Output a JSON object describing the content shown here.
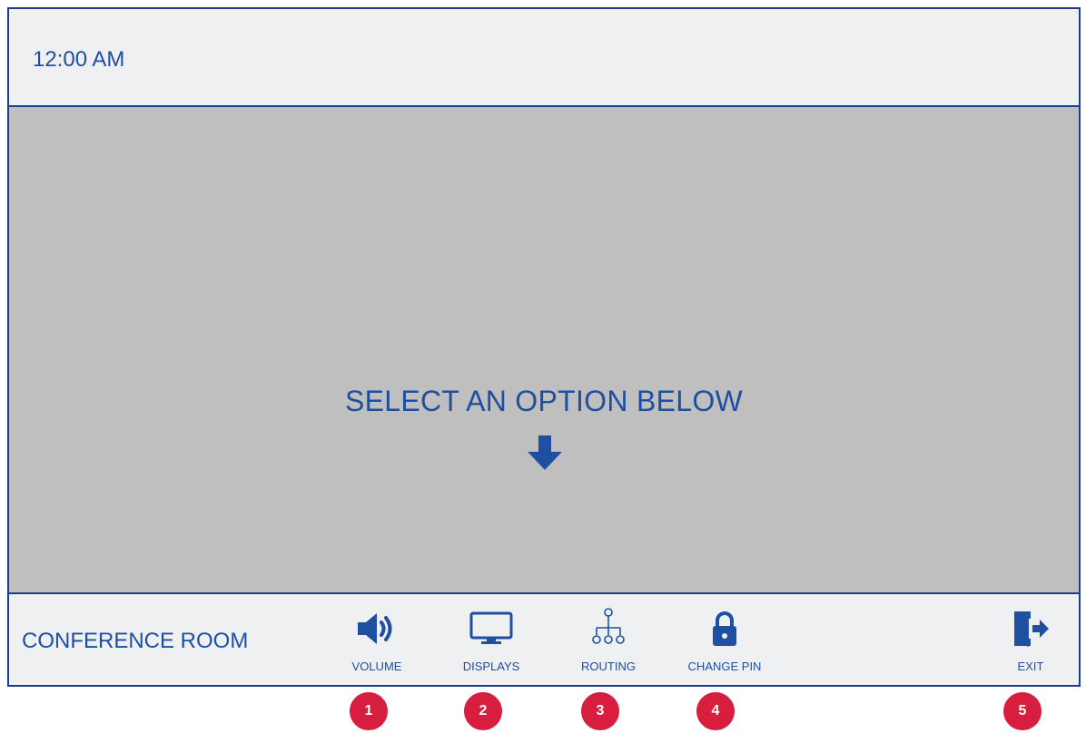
{
  "header": {
    "time": "12:00 AM"
  },
  "main": {
    "prompt": "SELECT AN OPTION BELOW",
    "arrow_icon": "arrow-down-icon"
  },
  "footer": {
    "room_name": "CONFERENCE ROOM",
    "buttons": [
      {
        "label": "VOLUME",
        "icon": "speaker-icon"
      },
      {
        "label": "DISPLAYS",
        "icon": "monitor-icon"
      },
      {
        "label": "ROUTING",
        "icon": "routing-tree-icon"
      },
      {
        "label": "CHANGE PIN",
        "icon": "lock-icon"
      },
      {
        "label": "EXIT",
        "icon": "exit-door-icon"
      }
    ]
  },
  "badges": [
    "1",
    "2",
    "3",
    "4",
    "5"
  ],
  "colors": {
    "accent": "#1e4fa0",
    "border": "#1b3f86",
    "bar": "#eff0f2",
    "main": "#bfbfbf",
    "badge": "#d81e3e"
  }
}
